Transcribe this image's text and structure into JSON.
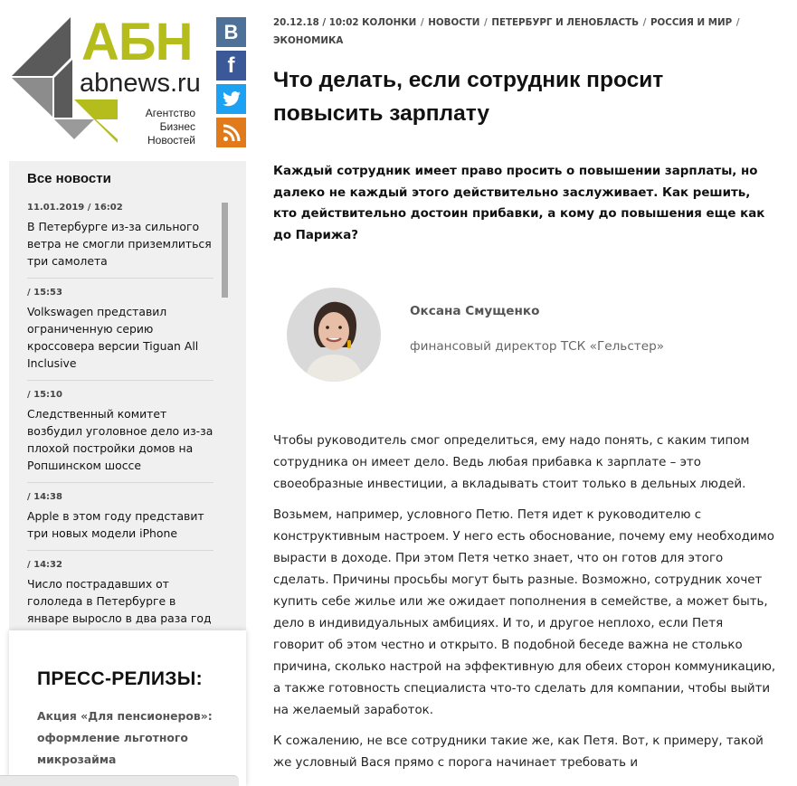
{
  "logo": {
    "abbr": "АБН",
    "domain": "abnews.ru",
    "subtitle_line1": "Агентство",
    "subtitle_line2": "Бизнес",
    "subtitle_line3": "Новостей",
    "colors": {
      "olive": "#b5bd1c",
      "dark": "#5a5a5a",
      "grey": "#9a9a9a"
    }
  },
  "social": {
    "vk": {
      "icon": "vk-icon",
      "glyph": "B",
      "color": "#4d7198"
    },
    "facebook": {
      "icon": "facebook-icon",
      "glyph": "f",
      "color": "#3b5998"
    },
    "twitter": {
      "icon": "twitter-icon",
      "color": "#1da1f2"
    },
    "rss": {
      "icon": "rss-icon",
      "color": "#e07a1b"
    }
  },
  "sidebar": {
    "news_title": "Все новости",
    "news": [
      {
        "date": "11.01.2019 / 16:02",
        "text": "В Петербурге из-за сильного ветра не смогли приземлиться три самолета"
      },
      {
        "date": "/ 15:53",
        "text": "Volkswagen представил ограниченную серию кроссовера версии Tiguan All Inclusive"
      },
      {
        "date": "/ 15:10",
        "text": "Следственный комитет возбудил уголовное дело из-за плохой постройки домов на Ропшинском шоссе"
      },
      {
        "date": "/ 14:38",
        "text": "Apple в этом году представит три новых модели iPhone"
      },
      {
        "date": "/ 14:32",
        "text": "Число пострадавших от гололеда в Петербурге в январе выросло в два раза год"
      }
    ],
    "press_title": "ПРЕСС-РЕЛИЗЫ:",
    "press_item": "Акция «Для пенсионеров»: оформление льготного микрозайма"
  },
  "article": {
    "date": "20.12.18 / 10:02",
    "categories": [
      "КОЛОНКИ",
      "НОВОСТИ",
      "ПЕТЕРБУРГ И ЛЕНОБЛАСТЬ",
      "РОССИЯ И МИР",
      "ЭКОНОМИКА"
    ],
    "separator": "/",
    "title": "Что делать, если сотрудник просит повысить зарплату",
    "lead": "Каждый сотрудник имеет право просить о повышении зарплаты, но далеко не каждый этого действительно заслуживает. Как решить, кто действительно достоин прибавки, а кому до повышения еще как до Парижа?",
    "author": {
      "name": "Оксана Смущенко",
      "role": "финансовый директор ТСК «Гельстер»"
    },
    "paragraphs": [
      "Чтобы руководитель смог определиться, ему надо понять, с каким типом сотрудника он имеет дело. Ведь любая прибавка к зарплате – это своеобразные инвестиции, а вкладывать стоит только в дельных людей.",
      "Возьмем, например, условного Петю. Петя идет к руководителю с конструктивным настроем. У него есть обоснование, почему ему необходимо вырасти в доходе. При этом Петя четко знает, что он готов для этого сделать. Причины просьбы могут быть разные. Возможно, сотрудник хочет купить себе жилье или же ожидает пополнения в семействе, а может быть, дело в индивидуальных амбициях. И то, и другое неплохо, если Петя говорит об этом честно и открыто. В подобной беседе важна не столько причина, сколько настрой на эффективную для обеих сторон коммуникацию, а также готовность специалиста что-то сделать для компании, чтобы выйти на желаемый заработок.",
      "К сожалению, не все сотрудники такие же, как Петя. Вот, к примеру, такой же условный Вася прямо с порога начинает требовать и"
    ]
  }
}
